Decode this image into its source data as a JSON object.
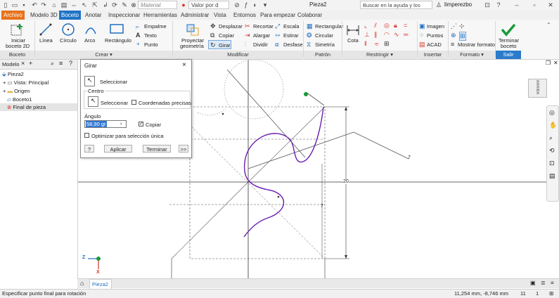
{
  "title_bar": {
    "material": "Material",
    "appearance": "Valor por d",
    "document": "Pieza2",
    "search_placeholder": "Buscar en la ayuda y los comandos",
    "user": "limperezbo"
  },
  "menu_tabs": [
    "Archivo",
    "Modelo 3D",
    "Boceto",
    "Anotar",
    "Inspeccionar",
    "Herramientas",
    "Administrar",
    "Vista",
    "Entornos",
    "Para empezar",
    "Colaborar"
  ],
  "active_tab": "Boceto",
  "ribbon": {
    "iniciar_boceto_1": "Iniciar",
    "iniciar_boceto_2": "boceto 2D",
    "linea": "Línea",
    "circulo": "Círculo",
    "arco": "Arco",
    "rectangulo": "Rectángulo",
    "empalme": "Empalme",
    "texto": "Texto",
    "punto": "Punto",
    "proyectar_1": "Proyectar",
    "proyectar_2": "geometría",
    "desplazar": "Desplazar",
    "copiar": "Copiar",
    "girar": "Girar",
    "recortar": "Recortar",
    "alargar": "Alargar",
    "dividir": "Dividir",
    "escala": "Escala",
    "estirar": "Estirar",
    "desfase": "Desfase",
    "rectangular": "Rectangular",
    "circular": "Circular",
    "simetria": "Simetría",
    "cota": "Cota",
    "imagen": "Imagen",
    "puntos": "Puntos",
    "acad": "ACAD",
    "mostrar_formato": "Mostrar formato",
    "terminar_1": "Terminar",
    "terminar_2": "boceto",
    "panels": {
      "boceto": "Boceto",
      "crear": "Crear ▾",
      "modificar": "Modificar",
      "patron": "Patrón",
      "restringir": "Restringir ▾",
      "insertar": "Insertar",
      "formato": "Formato ▾",
      "salir": "Salir"
    }
  },
  "browser": {
    "tab": "Modelo",
    "items": [
      "Pieza2",
      "Vista: Principal",
      "Origen",
      "Boceto1",
      "Final de pieza"
    ]
  },
  "dialog": {
    "title": "Girar",
    "select_label": "Seleccionar",
    "center_label": "Centro",
    "center_select": "Seleccionar",
    "precise_coords": "Coordenadas precisas",
    "angle_label": "Ángulo",
    "angle_value": "58,90 gr",
    "copy_label": "Copiar",
    "copy_checked": "✓",
    "optimize_label": "Optimizar para selección única",
    "apply": "Aplicar",
    "finish": "Terminar",
    "more": ">>"
  },
  "canvas": {
    "dim_20": "20",
    "dim_7a": "7",
    "dim_7b": "7",
    "axis_z": "Z",
    "axis_x": "X",
    "viewcube": "ARRIBA"
  },
  "doc_tab": "Pieza2",
  "status": {
    "prompt": "Especificar punto final para rotación",
    "coords": "11,254 mm, -8,746 mm",
    "n1": "11",
    "n2": "1"
  },
  "colors": {
    "orange_tab": "#e8721c",
    "active_blue": "#1f73c5",
    "sketch_curve": "#6a1fb0",
    "terminar_green": "#1a9a3a"
  }
}
